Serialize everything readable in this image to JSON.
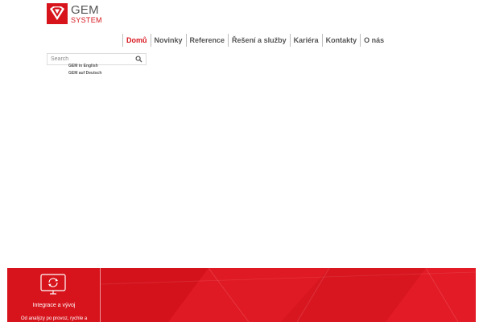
{
  "brand": {
    "name": "GEM",
    "subname": "SYSTEM",
    "colors": {
      "primary": "#d7141c",
      "text": "#555555"
    }
  },
  "nav": {
    "items": [
      {
        "label": "Domů",
        "active": true
      },
      {
        "label": "Novinky"
      },
      {
        "label": "Reference"
      },
      {
        "label": "Řešení a služby"
      },
      {
        "label": "Kariéra"
      },
      {
        "label": "Kontakty"
      },
      {
        "label": "O nás"
      }
    ]
  },
  "search": {
    "placeholder": "Search",
    "icon": "magnifier-icon"
  },
  "languages": [
    {
      "label": "GEM in English"
    },
    {
      "label": "GEM auf Deutsch"
    }
  ],
  "hero": {
    "card": {
      "icon": "monitor-sync-icon",
      "title": "Integrace a vývoj",
      "description": "Od analýzy po provoz, rychle a"
    }
  }
}
